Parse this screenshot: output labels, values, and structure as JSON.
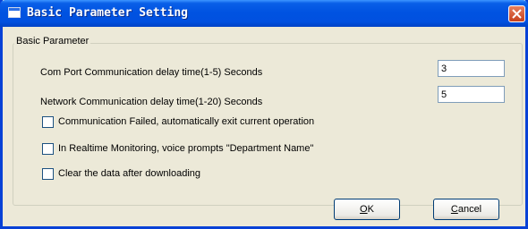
{
  "window": {
    "title": "Basic Parameter Setting"
  },
  "group": {
    "label": "Basic Parameter"
  },
  "fields": [
    {
      "label": "Com Port Communication delay time(1-5) Seconds",
      "value": "3"
    },
    {
      "label": "Network Communication delay time(1-20) Seconds",
      "value": "5"
    }
  ],
  "checkboxes": [
    {
      "label": "Communication Failed, automatically exit current operation",
      "checked": false
    },
    {
      "label": "In Realtime Monitoring, voice prompts \"Department Name\"",
      "checked": false
    },
    {
      "label": "Clear the data after downloading",
      "checked": false
    }
  ],
  "buttons": {
    "ok": {
      "mnemonic": "O",
      "rest": "K"
    },
    "cancel": {
      "mnemonic": "C",
      "rest": "ancel"
    }
  },
  "colors": {
    "titlebar": "#0053e1",
    "dialog_bg": "#ece9d8",
    "close_button": "#d7582f"
  },
  "icons": {
    "window_icon": "window-icon",
    "close": "close-icon"
  }
}
